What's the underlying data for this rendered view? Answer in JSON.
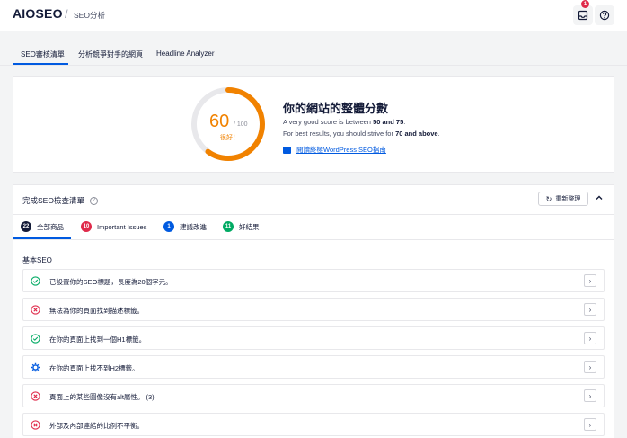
{
  "header": {
    "logo_text_left": "AIO",
    "logo_text_right": "SEO",
    "separator": "/",
    "breadcrumb": "SEO分析",
    "notification_count": "1",
    "inbox_icon": "inbox-icon",
    "help_icon": "help-circle-icon"
  },
  "tabs": [
    {
      "label": "SEO審核清單",
      "active": true
    },
    {
      "label": "分析競爭對手的網頁",
      "active": false
    },
    {
      "label": "Headline Analyzer",
      "active": false
    }
  ],
  "score": {
    "value": 60,
    "max": 100,
    "max_text": "/ 100",
    "value_text": "60",
    "rating": "很好！",
    "title": "你的網站的整體分數",
    "line1_prefix": "A very good score is between ",
    "line1_range": "50 and 75",
    "line1_suffix": ".",
    "line2_prefix": "For best results, you should strive for ",
    "line2_target": "70 and above",
    "line2_suffix": ".",
    "link": "閱讀終極WordPress SEO指南",
    "colors": {
      "gauge": "#f18200",
      "track": "#e8e8eb"
    }
  },
  "checklist": {
    "title": "完成SEO檢查清單",
    "refresh_label": "重新整理",
    "filters": [
      {
        "count": "22",
        "label": "全部商品",
        "color": "#141b38"
      },
      {
        "count": "10",
        "label": "Important Issues",
        "color": "#df2a4a"
      },
      {
        "count": "1",
        "label": "建議改進",
        "color": "#005ae0"
      },
      {
        "count": "11",
        "label": "好結果",
        "color": "#00aa63"
      }
    ],
    "section_title": "基本SEO",
    "items": [
      {
        "status": "good",
        "icon": "check-circle-icon",
        "text": "已設置你的SEO標題，長度為20個字元。"
      },
      {
        "status": "bad",
        "icon": "x-circle-icon",
        "text": "無法為你的頁面找到描述標籤。"
      },
      {
        "status": "good",
        "icon": "check-circle-icon",
        "text": "在你的頁面上找到一個H1標籤。"
      },
      {
        "status": "info",
        "icon": "gear-icon",
        "text": "在你的頁面上找不到H2標籤。"
      },
      {
        "status": "bad",
        "icon": "x-circle-icon",
        "text": "頁面上的某些圖像沒有alt屬性。 (3)"
      },
      {
        "status": "bad",
        "icon": "x-circle-icon",
        "text": "外部及內部連結的比例不平衡。"
      }
    ],
    "colors": {
      "good": "#00aa63",
      "bad": "#df2a4a",
      "info": "#005ae0"
    }
  }
}
